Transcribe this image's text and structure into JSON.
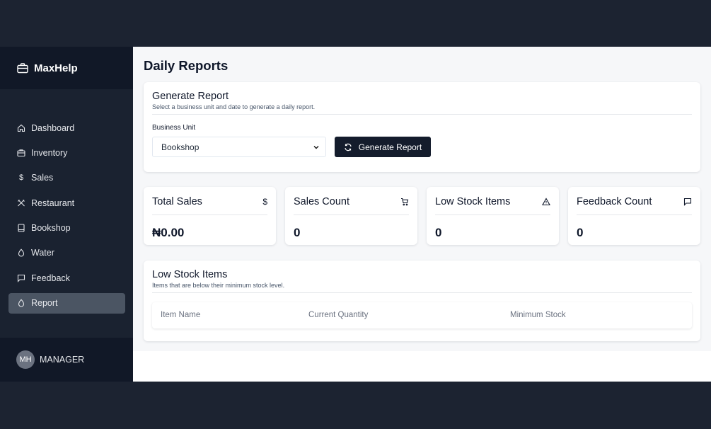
{
  "app": {
    "brand": "MaxHelp"
  },
  "sidebar": {
    "items": [
      {
        "label": "Dashboard",
        "icon": "home-icon",
        "active": false
      },
      {
        "label": "Inventory",
        "icon": "briefcase-icon",
        "active": false
      },
      {
        "label": "Sales",
        "icon": "dollar-icon",
        "active": false
      },
      {
        "label": "Restaurant",
        "icon": "utensils-icon",
        "active": false
      },
      {
        "label": "Bookshop",
        "icon": "book-icon",
        "active": false
      },
      {
        "label": "Water",
        "icon": "droplet-icon",
        "active": false
      },
      {
        "label": "Feedback",
        "icon": "message-icon",
        "active": false
      },
      {
        "label": "Report",
        "icon": "droplet-icon",
        "active": true
      }
    ],
    "user": {
      "initials": "MH",
      "role": "MANAGER"
    }
  },
  "main": {
    "title": "Daily Reports",
    "generate": {
      "title": "Generate Report",
      "subtitle": "Select a business unit and date to generate a daily report.",
      "field_label": "Business Unit",
      "selected_unit": "Bookshop",
      "button_label": "Generate Report"
    },
    "stats": [
      {
        "title": "Total Sales",
        "icon": "dollar-icon",
        "value": "₦0.00"
      },
      {
        "title": "Sales Count",
        "icon": "cart-icon",
        "value": "0"
      },
      {
        "title": "Low Stock Items",
        "icon": "alert-triangle-icon",
        "value": "0"
      },
      {
        "title": "Feedback Count",
        "icon": "message-icon",
        "value": "0"
      }
    ],
    "low_stock": {
      "title": "Low Stock Items",
      "subtitle": "Items that are below their minimum stock level.",
      "columns": [
        "Item Name",
        "Current Quantity",
        "Minimum Stock"
      ],
      "rows": []
    }
  },
  "colors": {
    "sidebar_bg": "#1a2230",
    "brand_bg": "#111827",
    "accent_button": "#141c2c",
    "active_item": "#4b5563"
  }
}
